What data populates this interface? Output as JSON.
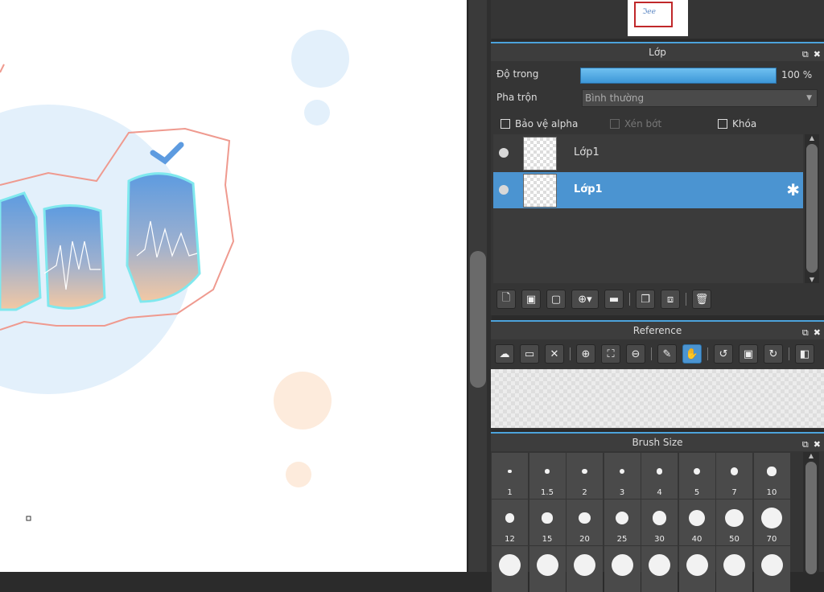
{
  "layer_panel": {
    "title": "Lớp",
    "opacity_label": "Độ trong",
    "opacity_value": "100 %",
    "opacity_fraction": 1.0,
    "blend_label": "Pha trộn",
    "blend_value": "Bình thường",
    "protect_alpha": "Bảo vệ alpha",
    "clipping": "Xén bớt",
    "lock": "Khóa",
    "layers": [
      {
        "name": "Lớp1",
        "selected": false
      },
      {
        "name": "Lớp1",
        "selected": true
      }
    ]
  },
  "reference_panel": {
    "title": "Reference"
  },
  "brush_panel": {
    "title": "Brush Size",
    "sizes": [
      "1",
      "1.5",
      "2",
      "3",
      "4",
      "5",
      "7",
      "10",
      "12",
      "15",
      "20",
      "25",
      "30",
      "40",
      "50",
      "70"
    ]
  },
  "colors": {
    "accent": "#4b94d1",
    "panel_bg": "#353535",
    "canvas_bg": "#ffffff"
  }
}
